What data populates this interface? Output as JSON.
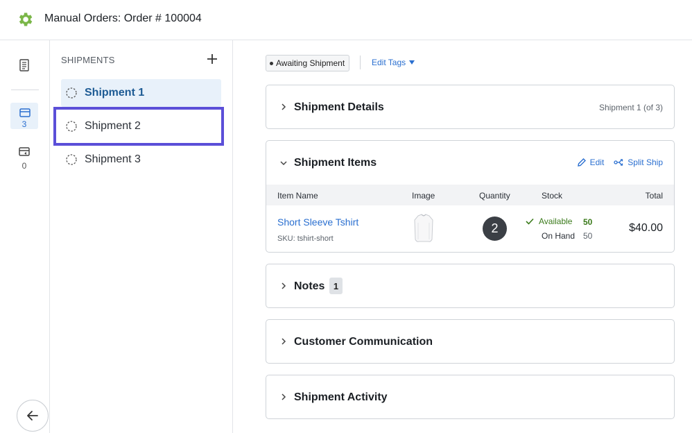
{
  "header": {
    "title": "Manual Orders:  Order # 100004"
  },
  "rail": {
    "shipments_count": "3",
    "returns_count": "0"
  },
  "shipments_panel": {
    "heading": "SHIPMENTS",
    "items": [
      {
        "label": "Shipment 1"
      },
      {
        "label": "Shipment 2"
      },
      {
        "label": "Shipment 3"
      }
    ]
  },
  "tags": {
    "status_tag": "Awaiting Shipment",
    "edit_tags_label": "Edit Tags"
  },
  "shipment_details": {
    "title": "Shipment Details",
    "note": "Shipment 1 (of 3)"
  },
  "shipment_items": {
    "title": "Shipment Items",
    "edit_label": "Edit",
    "split_label": "Split Ship",
    "columns": [
      "Item Name",
      "Image",
      "Quantity",
      "Stock",
      "Total"
    ],
    "row": {
      "name": "Short Sleeve Tshirt",
      "sku": "SKU: tshirt-short",
      "quantity": "2",
      "available_label": "Available",
      "available_value": "50",
      "on_hand_label": "On Hand",
      "on_hand_value": "50",
      "total": "$40.00"
    }
  },
  "notes": {
    "title": "Notes",
    "count": "1"
  },
  "customer_communication": {
    "title": "Customer Communication"
  },
  "shipment_activity": {
    "title": "Shipment Activity"
  },
  "colors": {
    "accent": "#2a6fd0",
    "selected_outline": "#5b4fd8",
    "gear": "#7ab648",
    "available": "#3a7a1a"
  }
}
